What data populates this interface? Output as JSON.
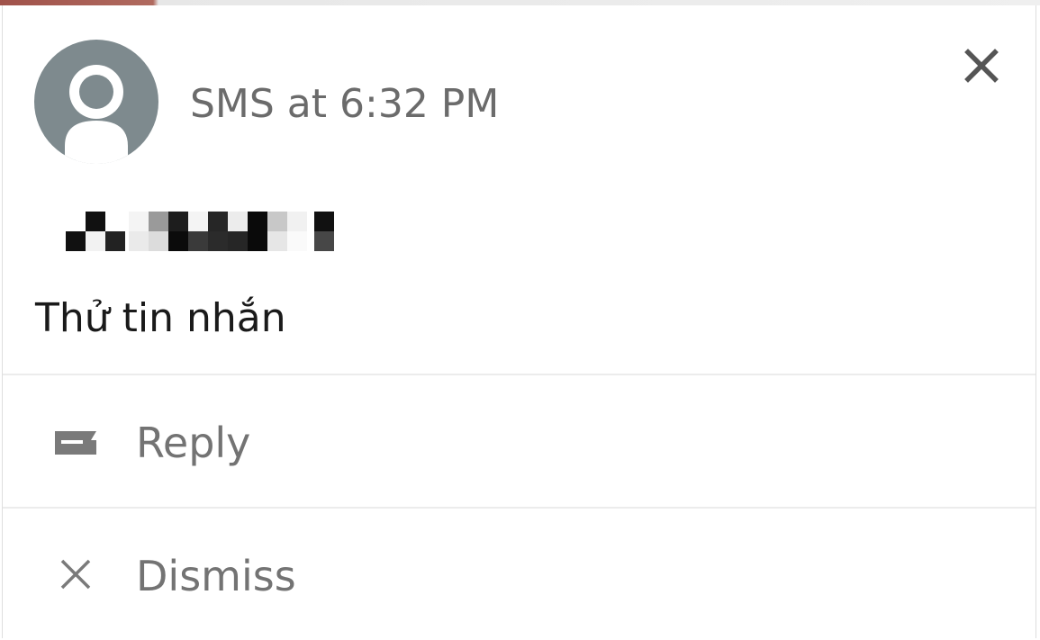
{
  "notification": {
    "header_title": "SMS at 6:32 PM",
    "sender_redacted": true,
    "message_text": "Thử tin nhắn",
    "close_icon": "close-icon",
    "avatar_icon": "person-avatar-icon"
  },
  "actions": [
    {
      "label": "Reply",
      "icon": "reply-message-icon"
    },
    {
      "label": "Dismiss",
      "icon": "dismiss-x-icon"
    }
  ],
  "colors": {
    "avatar_bg": "#7e8a8e",
    "header_text": "#6b6b6b",
    "message_text": "#1a1a1a",
    "action_text": "#737373",
    "divider": "#ececec"
  }
}
